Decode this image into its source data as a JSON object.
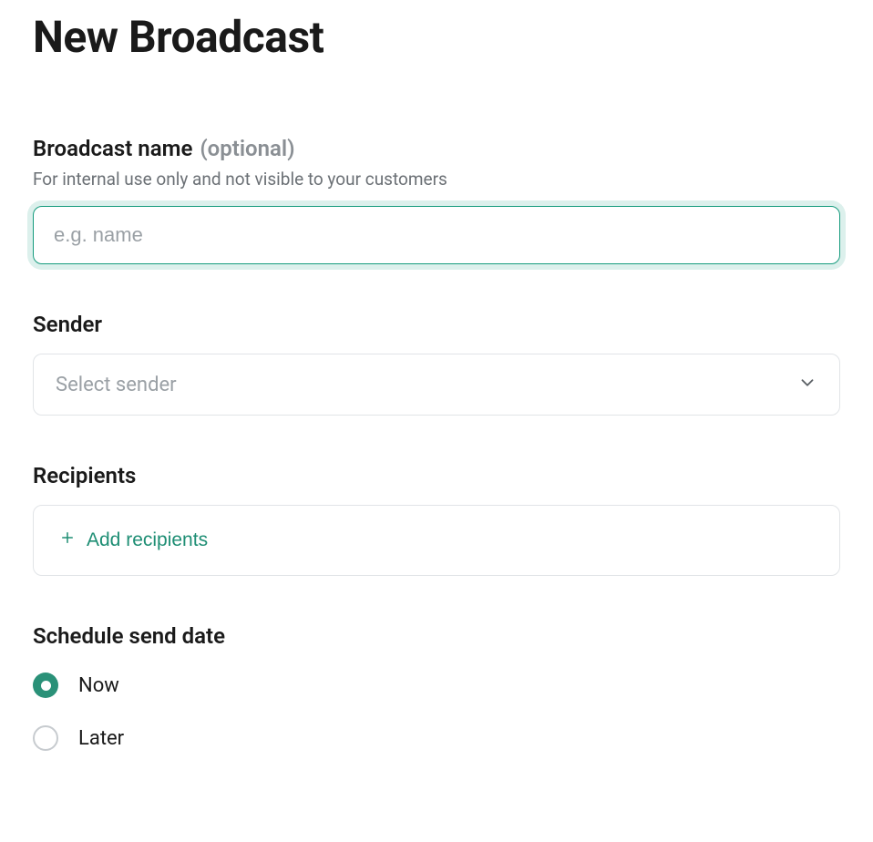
{
  "page": {
    "title": "New Broadcast"
  },
  "broadcast_name": {
    "label": "Broadcast name",
    "label_suffix": "(optional)",
    "hint": "For internal use only and not visible to your customers",
    "placeholder": "e.g. name",
    "value": ""
  },
  "sender": {
    "label": "Sender",
    "placeholder": "Select sender"
  },
  "recipients": {
    "label": "Recipients",
    "add_button": "Add recipients"
  },
  "schedule": {
    "label": "Schedule send date",
    "options": {
      "now": "Now",
      "later": "Later"
    },
    "selected": "now"
  },
  "colors": {
    "accent": "#2a9178",
    "focus_ring": "rgba(21,155,125,0.15)"
  }
}
